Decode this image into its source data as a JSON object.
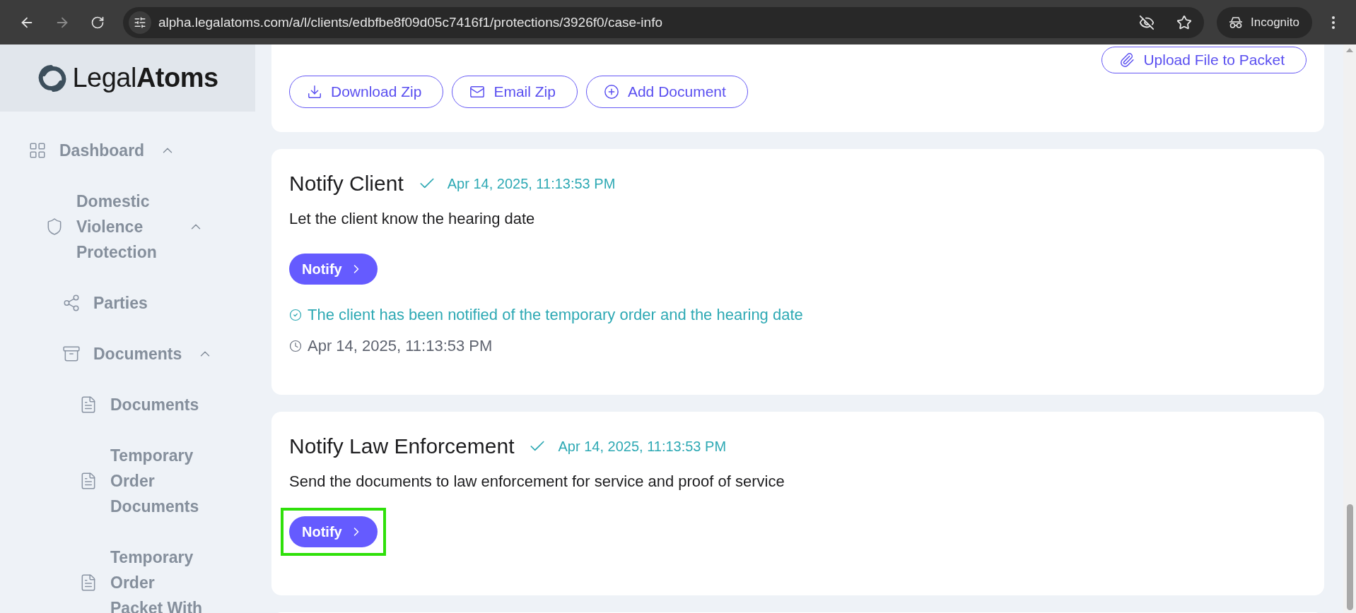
{
  "browser": {
    "url": "alpha.legalatoms.com/a/l/clients/edbfbe8f09d05c7416f1/protections/3926f0/case-info",
    "profile_label": "Incognito"
  },
  "sidebar": {
    "logo": {
      "text_light": "Legal",
      "text_bold": "Atoms"
    },
    "items": [
      {
        "label": "Dashboard",
        "kind": "dashboard",
        "expanded": true,
        "children": [
          {
            "label": "Domestic Violence Protection",
            "kind": "case",
            "expanded": true,
            "children": [
              {
                "label": "Parties",
                "kind": "parties"
              },
              {
                "label": "Documents",
                "kind": "folder",
                "expanded": true,
                "children": [
                  {
                    "label": "Documents",
                    "kind": "document"
                  },
                  {
                    "label": "Temporary Order Documents",
                    "kind": "document"
                  },
                  {
                    "label": "Temporary Order Packet With",
                    "kind": "document"
                  }
                ]
              }
            ]
          }
        ]
      }
    ]
  },
  "packet_card": {
    "upload_button": "Upload File to Packet",
    "buttons": [
      {
        "label": "Download Zip",
        "kind": "download"
      },
      {
        "label": "Email Zip",
        "kind": "email"
      },
      {
        "label": "Add Document",
        "kind": "add"
      }
    ]
  },
  "tasks": [
    {
      "title": "Notify Client",
      "done": true,
      "completed_at": "Apr 14, 2025, 11:13:53 PM",
      "description": "Let the client know the hearing date",
      "action": {
        "label": "Notify",
        "highlighted": false
      },
      "result": {
        "message": "The client has been notified of the temporary order and the hearing date",
        "time": "Apr 14, 2025, 11:13:53 PM"
      }
    },
    {
      "title": "Notify Law Enforcement",
      "done": true,
      "completed_at": "Apr 14, 2025, 11:13:53 PM",
      "description": "Send the documents to law enforcement for service and proof of service",
      "action": {
        "label": "Notify",
        "highlighted": true
      }
    }
  ]
}
